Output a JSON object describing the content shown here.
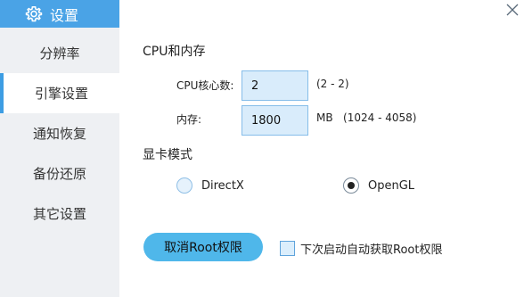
{
  "titlebar": {
    "title": "设置",
    "icon": "gear-icon",
    "close_icon": "close-icon"
  },
  "sidebar": {
    "items": [
      {
        "label": "分辨率",
        "active": false
      },
      {
        "label": "引擎设置",
        "active": true
      },
      {
        "label": "通知恢复",
        "active": false
      },
      {
        "label": "备份还原",
        "active": false
      },
      {
        "label": "其它设置",
        "active": false
      }
    ]
  },
  "cpu_memory": {
    "section_title": "CPU和内存",
    "cpu_label": "CPU核心数:",
    "cpu_value": "2",
    "cpu_range": "(2 - 2)",
    "mem_label": "内存:",
    "mem_value": "1800",
    "mem_unit_range": "MB   (1024 - 4058)"
  },
  "graphics": {
    "section_title": "显卡模式",
    "options": [
      {
        "label": "DirectX",
        "selected": false
      },
      {
        "label": "OpenGL",
        "selected": true
      }
    ]
  },
  "root": {
    "button_label": "取消Root权限",
    "checkbox_label": "下次启动自动获取Root权限",
    "checkbox_checked": false
  },
  "colors": {
    "accent": "#4aa3e6",
    "sidebar_bg": "#eef0f3",
    "input_bg": "#d9ecfb",
    "button_bg": "#4fb7ea"
  }
}
